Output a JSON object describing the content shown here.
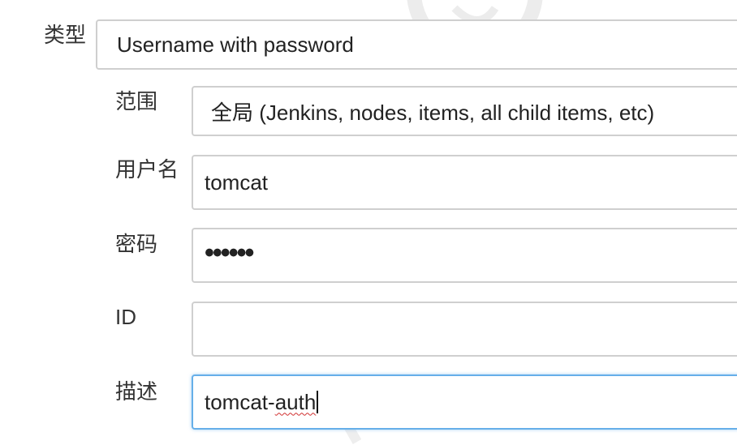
{
  "form": {
    "kind": {
      "label": "类型",
      "value": "Username with password"
    },
    "scope": {
      "label": "范围",
      "value": "全局 (Jenkins, nodes, items, all child items, etc)"
    },
    "username": {
      "label": "用户名",
      "value": "tomcat"
    },
    "password": {
      "label": "密码",
      "value": "••••••"
    },
    "id": {
      "label": "ID",
      "value": ""
    },
    "description": {
      "label": "描述",
      "value_prefix": "tomcat-",
      "value_misspelled": "auth"
    }
  },
  "watermark": {
    "text": "™"
  },
  "colors": {
    "focus_border": "#66afe9",
    "field_border": "#cfcfcf"
  }
}
